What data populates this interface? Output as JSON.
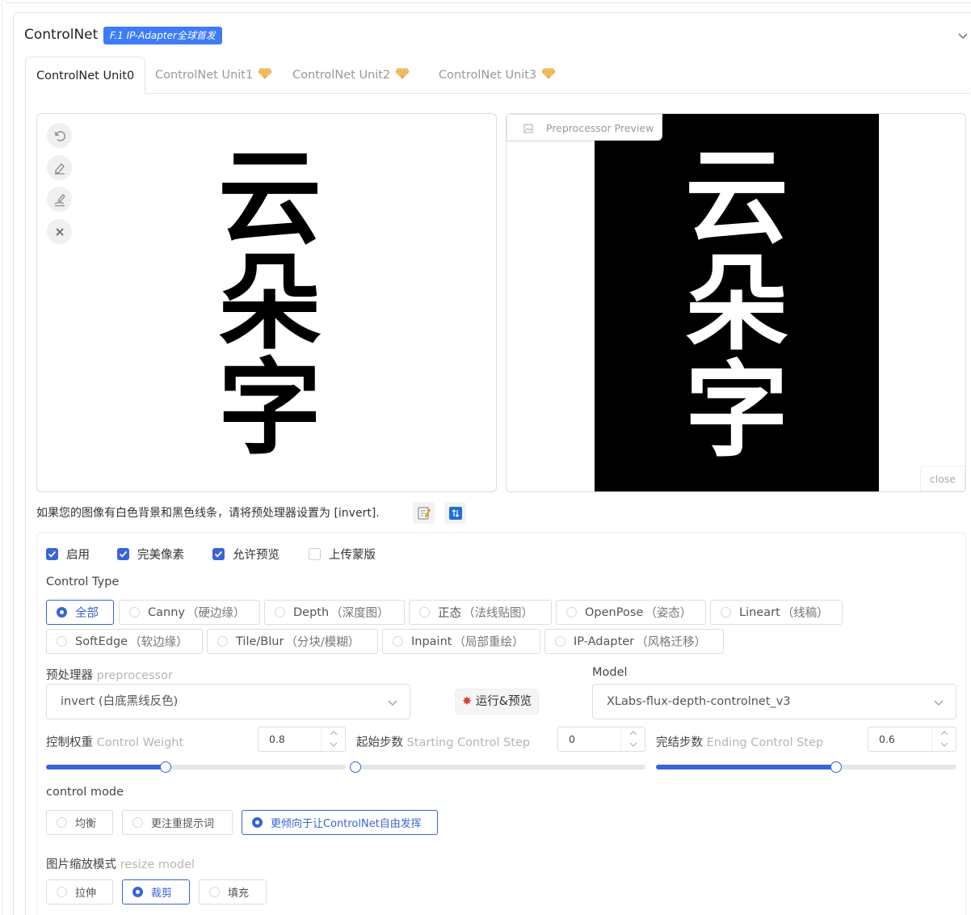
{
  "colors": {
    "accent": "#3864d8",
    "badge": "#3d7bf7",
    "preview_bg": "#000000"
  },
  "header": {
    "title": "ControlNet",
    "badge": "F.1 IP-Adapter全球首发"
  },
  "tabs": [
    {
      "label": "ControlNet Unit0",
      "active": true
    },
    {
      "label": "ControlNet Unit1",
      "icon": "gem-icon"
    },
    {
      "label": "ControlNet Unit2",
      "icon": "gem-icon"
    },
    {
      "label": "ControlNet Unit3",
      "icon": "gem-icon"
    }
  ],
  "input_canvas": {
    "tools": [
      "undo-icon",
      "eraser-icon",
      "brush-icon",
      "close-icon"
    ],
    "glyphs": [
      "云",
      "朵",
      "字"
    ]
  },
  "preview": {
    "tag": "Preprocessor Preview",
    "close": "close",
    "glyphs": [
      "云",
      "朵",
      "字"
    ]
  },
  "hint": {
    "text": "如果您的图像有白色背景和黑色线条，请将预处理器设置为 [invert].",
    "buttons": [
      "memo-icon",
      "swap-icon"
    ]
  },
  "checkboxes": [
    {
      "label": "启用",
      "checked": true
    },
    {
      "label": "完美像素",
      "checked": true
    },
    {
      "label": "允许预览",
      "checked": true
    },
    {
      "label": "上传蒙版",
      "checked": false
    }
  ],
  "control_type": {
    "label": "Control Type",
    "options": [
      {
        "main": "全部",
        "sub": "",
        "selected": true
      },
      {
        "main": "Canny",
        "sub": "（硬边缘）"
      },
      {
        "main": "Depth",
        "sub": "（深度图）"
      },
      {
        "main": "正态",
        "sub": "（法线贴图）"
      },
      {
        "main": "OpenPose",
        "sub": "（姿态）"
      },
      {
        "main": "Lineart",
        "sub": "（线稿）"
      },
      {
        "main": "SoftEdge",
        "sub": "（软边缘）"
      },
      {
        "main": "Tile/Blur",
        "sub": "（分块/模糊）"
      },
      {
        "main": "Inpaint",
        "sub": "（局部重绘）"
      },
      {
        "main": "IP-Adapter",
        "sub": "（风格迁移）"
      }
    ]
  },
  "preprocessor": {
    "label_cn": "预处理器",
    "label_en": "preprocessor",
    "value": "invert (白底黑线反色)"
  },
  "run_button": "运行&预览",
  "model": {
    "label": "Model",
    "value": "XLabs-flux-depth-controlnet_v3"
  },
  "weight": {
    "label_cn": "控制权重",
    "label_en": "Control Weight",
    "value": "0.8",
    "fraction": 0.4
  },
  "start_step": {
    "label_cn": "起始步数",
    "label_en": "Starting Control Step",
    "value": "0",
    "fraction": 0.0
  },
  "end_step": {
    "label_cn": "完结步数",
    "label_en": "Ending Control Step",
    "value": "0.6",
    "fraction": 0.6
  },
  "control_mode": {
    "label": "control mode",
    "options": [
      {
        "label": "均衡"
      },
      {
        "label": "更注重提示词"
      },
      {
        "label": "更倾向于让ControlNet自由发挥",
        "selected": true
      }
    ]
  },
  "resize_mode": {
    "label_cn": "图片缩放模式",
    "label_en": "resize model",
    "options": [
      {
        "label": "拉伸"
      },
      {
        "label": "裁剪",
        "selected": true
      },
      {
        "label": "填充"
      }
    ]
  }
}
